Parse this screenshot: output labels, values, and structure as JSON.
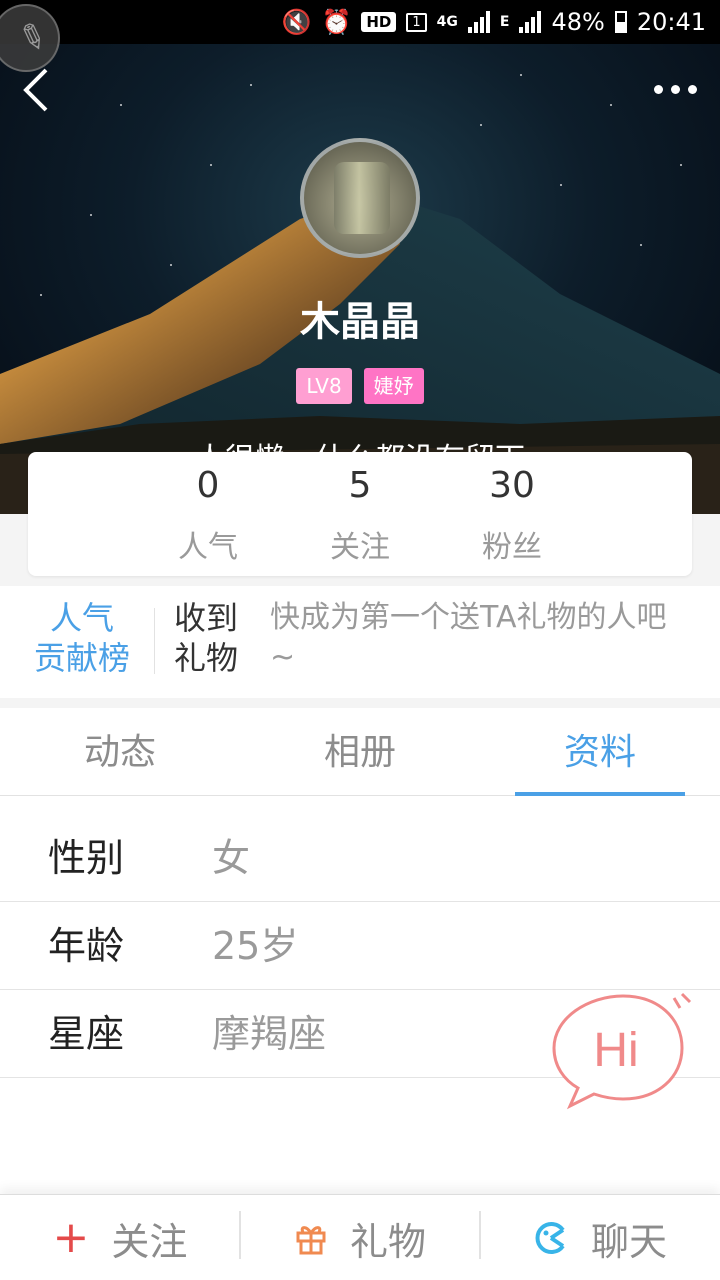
{
  "status_bar": {
    "network_type": "4G",
    "edge": "E",
    "hd": "HD",
    "sim": "1",
    "battery": "48%",
    "time": "20:41"
  },
  "profile": {
    "name": "木晶晶",
    "level": "LV8",
    "tag": "婕妤",
    "bio": "人很懒，什么都没有留下"
  },
  "stats": [
    {
      "value": "0",
      "label": "人气"
    },
    {
      "value": "5",
      "label": "关注"
    },
    {
      "value": "30",
      "label": "粉丝"
    }
  ],
  "gifts": {
    "rank_label": "人气\n贡献榜",
    "title": "收到\n礼物",
    "hint": "快成为第一个送TA礼物的人吧~"
  },
  "tabs": [
    {
      "label": "动态"
    },
    {
      "label": "相册"
    },
    {
      "label": "资料"
    }
  ],
  "active_tab": "资料",
  "info": [
    {
      "key": "性别",
      "value": "女"
    },
    {
      "key": "年龄",
      "value": "25岁"
    },
    {
      "key": "星座",
      "value": "摩羯座"
    }
  ],
  "hi_bubble": "Hi",
  "bottom_bar": {
    "follow": "关注",
    "gift": "礼物",
    "chat": "聊天"
  },
  "colors": {
    "accent": "#4aa0e6",
    "level_badge": "#ff9fd2",
    "tag_badge": "#ff74c5",
    "hi": "#f08a8a",
    "follow_plus": "#e44a4a",
    "gift_icon": "#f08a50",
    "chat_icon": "#38b4e8"
  }
}
